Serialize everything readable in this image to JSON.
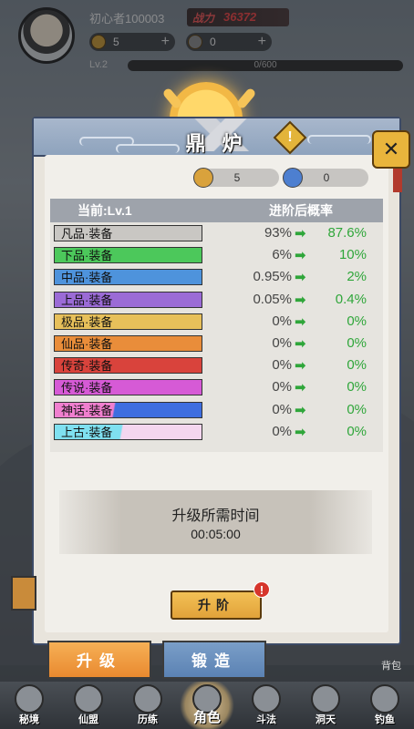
{
  "player": {
    "name": "初心者100003",
    "power": "36372",
    "power_icon": "战力",
    "currency1": "5",
    "currency2": "0",
    "level": "Lv.2",
    "xp": "0/600"
  },
  "panel": {
    "title": "鼎 炉",
    "res1": "5",
    "res2": "0",
    "header_current": "当前:Lv.1",
    "header_prob": "进阶后概率",
    "rows": [
      {
        "label": "凡品·装备",
        "from": "93%",
        "to": "87.6%",
        "color": "#c9c7c3"
      },
      {
        "label": "下品·装备",
        "from": "6%",
        "to": "10%",
        "color": "#4cc85b"
      },
      {
        "label": "中品·装备",
        "from": "0.95%",
        "to": "2%",
        "color": "#4e93dc"
      },
      {
        "label": "上品·装备",
        "from": "0.05%",
        "to": "0.4%",
        "color": "#9b6bd6"
      },
      {
        "label": "极品·装备",
        "from": "0%",
        "to": "0%",
        "color": "#e7c05a"
      },
      {
        "label": "仙品·装备",
        "from": "0%",
        "to": "0%",
        "color": "#e98d3a"
      },
      {
        "label": "传奇·装备",
        "from": "0%",
        "to": "0%",
        "color": "#d9433c"
      },
      {
        "label": "传说·装备",
        "from": "0%",
        "to": "0%",
        "color": "#d65ad6"
      },
      {
        "label": "神话·装备",
        "from": "0%",
        "to": "0%",
        "color": "linear-gradient(100deg,#f07fcf 0 40%,#3e6ee0 41% 100%)"
      },
      {
        "label": "上古·装备",
        "from": "0%",
        "to": "0%",
        "color": "linear-gradient(100deg,#7fe0f0 0 45%,#f4d6ef 46% 100%)"
      }
    ],
    "time_label": "升级所需时间",
    "time_value": "00:05:00",
    "upgrade_button": "升阶",
    "upgrade_badge": "!",
    "arrow": "➡"
  },
  "tabs": {
    "active": "升级",
    "inactive": "锻造"
  },
  "side": {
    "bag": "背包"
  },
  "nav": {
    "items": [
      "秘境",
      "仙盟",
      "历练",
      "角色",
      "斗法",
      "洞天",
      "钓鱼"
    ],
    "selected_index": 3
  }
}
